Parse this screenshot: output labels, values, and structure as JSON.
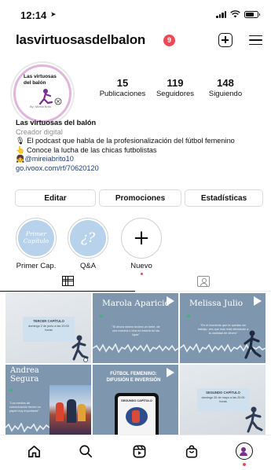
{
  "status_bar": {
    "time": "12:14"
  },
  "header": {
    "username": "lasvirtuosasdelbalon",
    "notification_count": "9"
  },
  "profile": {
    "avatar_title": "Las virtuosas del balón",
    "avatar_subtitle": "By: Mireia Brito",
    "stats": [
      {
        "value": "15",
        "label": "Publicaciones"
      },
      {
        "value": "119",
        "label": "Seguidores"
      },
      {
        "value": "148",
        "label": "Siguiendo"
      }
    ],
    "name": "Las virtuosas del balón",
    "category": "Creador digital",
    "bio_line1": "🎙 El podcast que habla de la profesionalización del fútbol femenino",
    "bio_line2": "👆 Conoce la lucha de las chicas futbolistas",
    "mention_emoji": "👧",
    "mention": "@mireiabrito10",
    "link": "go.ivoox.com/rf/70620120"
  },
  "buttons": {
    "edit": "Editar",
    "promotions": "Promociones",
    "stats": "Estadísticas"
  },
  "highlights": [
    {
      "label": "Primer Cap.",
      "cover_text": "Primer Capítulo"
    },
    {
      "label": "Q&A",
      "cover_text": "¿?"
    },
    {
      "label": "Nuevo"
    }
  ],
  "posts": [
    {
      "card_title": "TERCER CAPÍTULO",
      "card_text": "domingo 2 de junio a las 20:00 horas"
    },
    {
      "title": "Marola Aparicio",
      "quote": "\"Si ahora mismo tuviera un bebé, de una manera u otra no estaría en las ligas\""
    },
    {
      "title": "Melissa Julio",
      "quote": "\"En el momento que te quedas sin trabajo, ves que esto está afectando a la cantidad de dinero\""
    },
    {
      "title": "Andrea Segura",
      "quote": "\"Los medios de comunicación tienen un papel muy importante\""
    },
    {
      "title": "FÚTBOL FEMENINO: DIFUSIÓN E INVERSIÓN",
      "screen_text": "SEGUNDO CAPÍTULO"
    },
    {
      "card_title": "SEGUNDO CAPÍTULO",
      "card_text": "domingo 26 de mayo a las 20:00 horas"
    }
  ],
  "nav": [
    "home-icon",
    "search-icon",
    "reels-icon",
    "shop-icon",
    "profile-icon"
  ],
  "colors": {
    "notification": "#ed4956",
    "link": "#1c3f7a",
    "highlight_fill": "#b8d2ec",
    "post_slate": "#7f97ae",
    "quote_green": "#3fb37d"
  }
}
